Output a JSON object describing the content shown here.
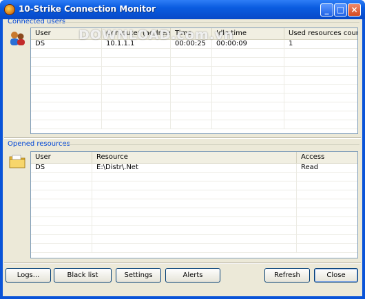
{
  "window": {
    "title": "10-Strike Connection Monitor"
  },
  "watermark": "DOWNLOAD.com.vn",
  "connected_users": {
    "label": "Connected users",
    "icon": "users-icon",
    "columns": [
      "User",
      "Computer (address)",
      "Time",
      "Idle time",
      "Used resources count"
    ],
    "rows": [
      [
        "DS",
        "10.1.1.1",
        "00:00:25",
        "00:00:09",
        "1"
      ]
    ]
  },
  "opened_resources": {
    "label": "Opened resources",
    "icon": "folder-icon",
    "columns": [
      "User",
      "Resource",
      "Access"
    ],
    "rows": [
      [
        "DS",
        "E:\\Distr\\.Net",
        "Read"
      ]
    ]
  },
  "buttons": {
    "logs": "Logs...",
    "black_list": "Black list",
    "settings": "Settings",
    "alerts": "Alerts",
    "refresh": "Refresh",
    "close": "Close"
  }
}
